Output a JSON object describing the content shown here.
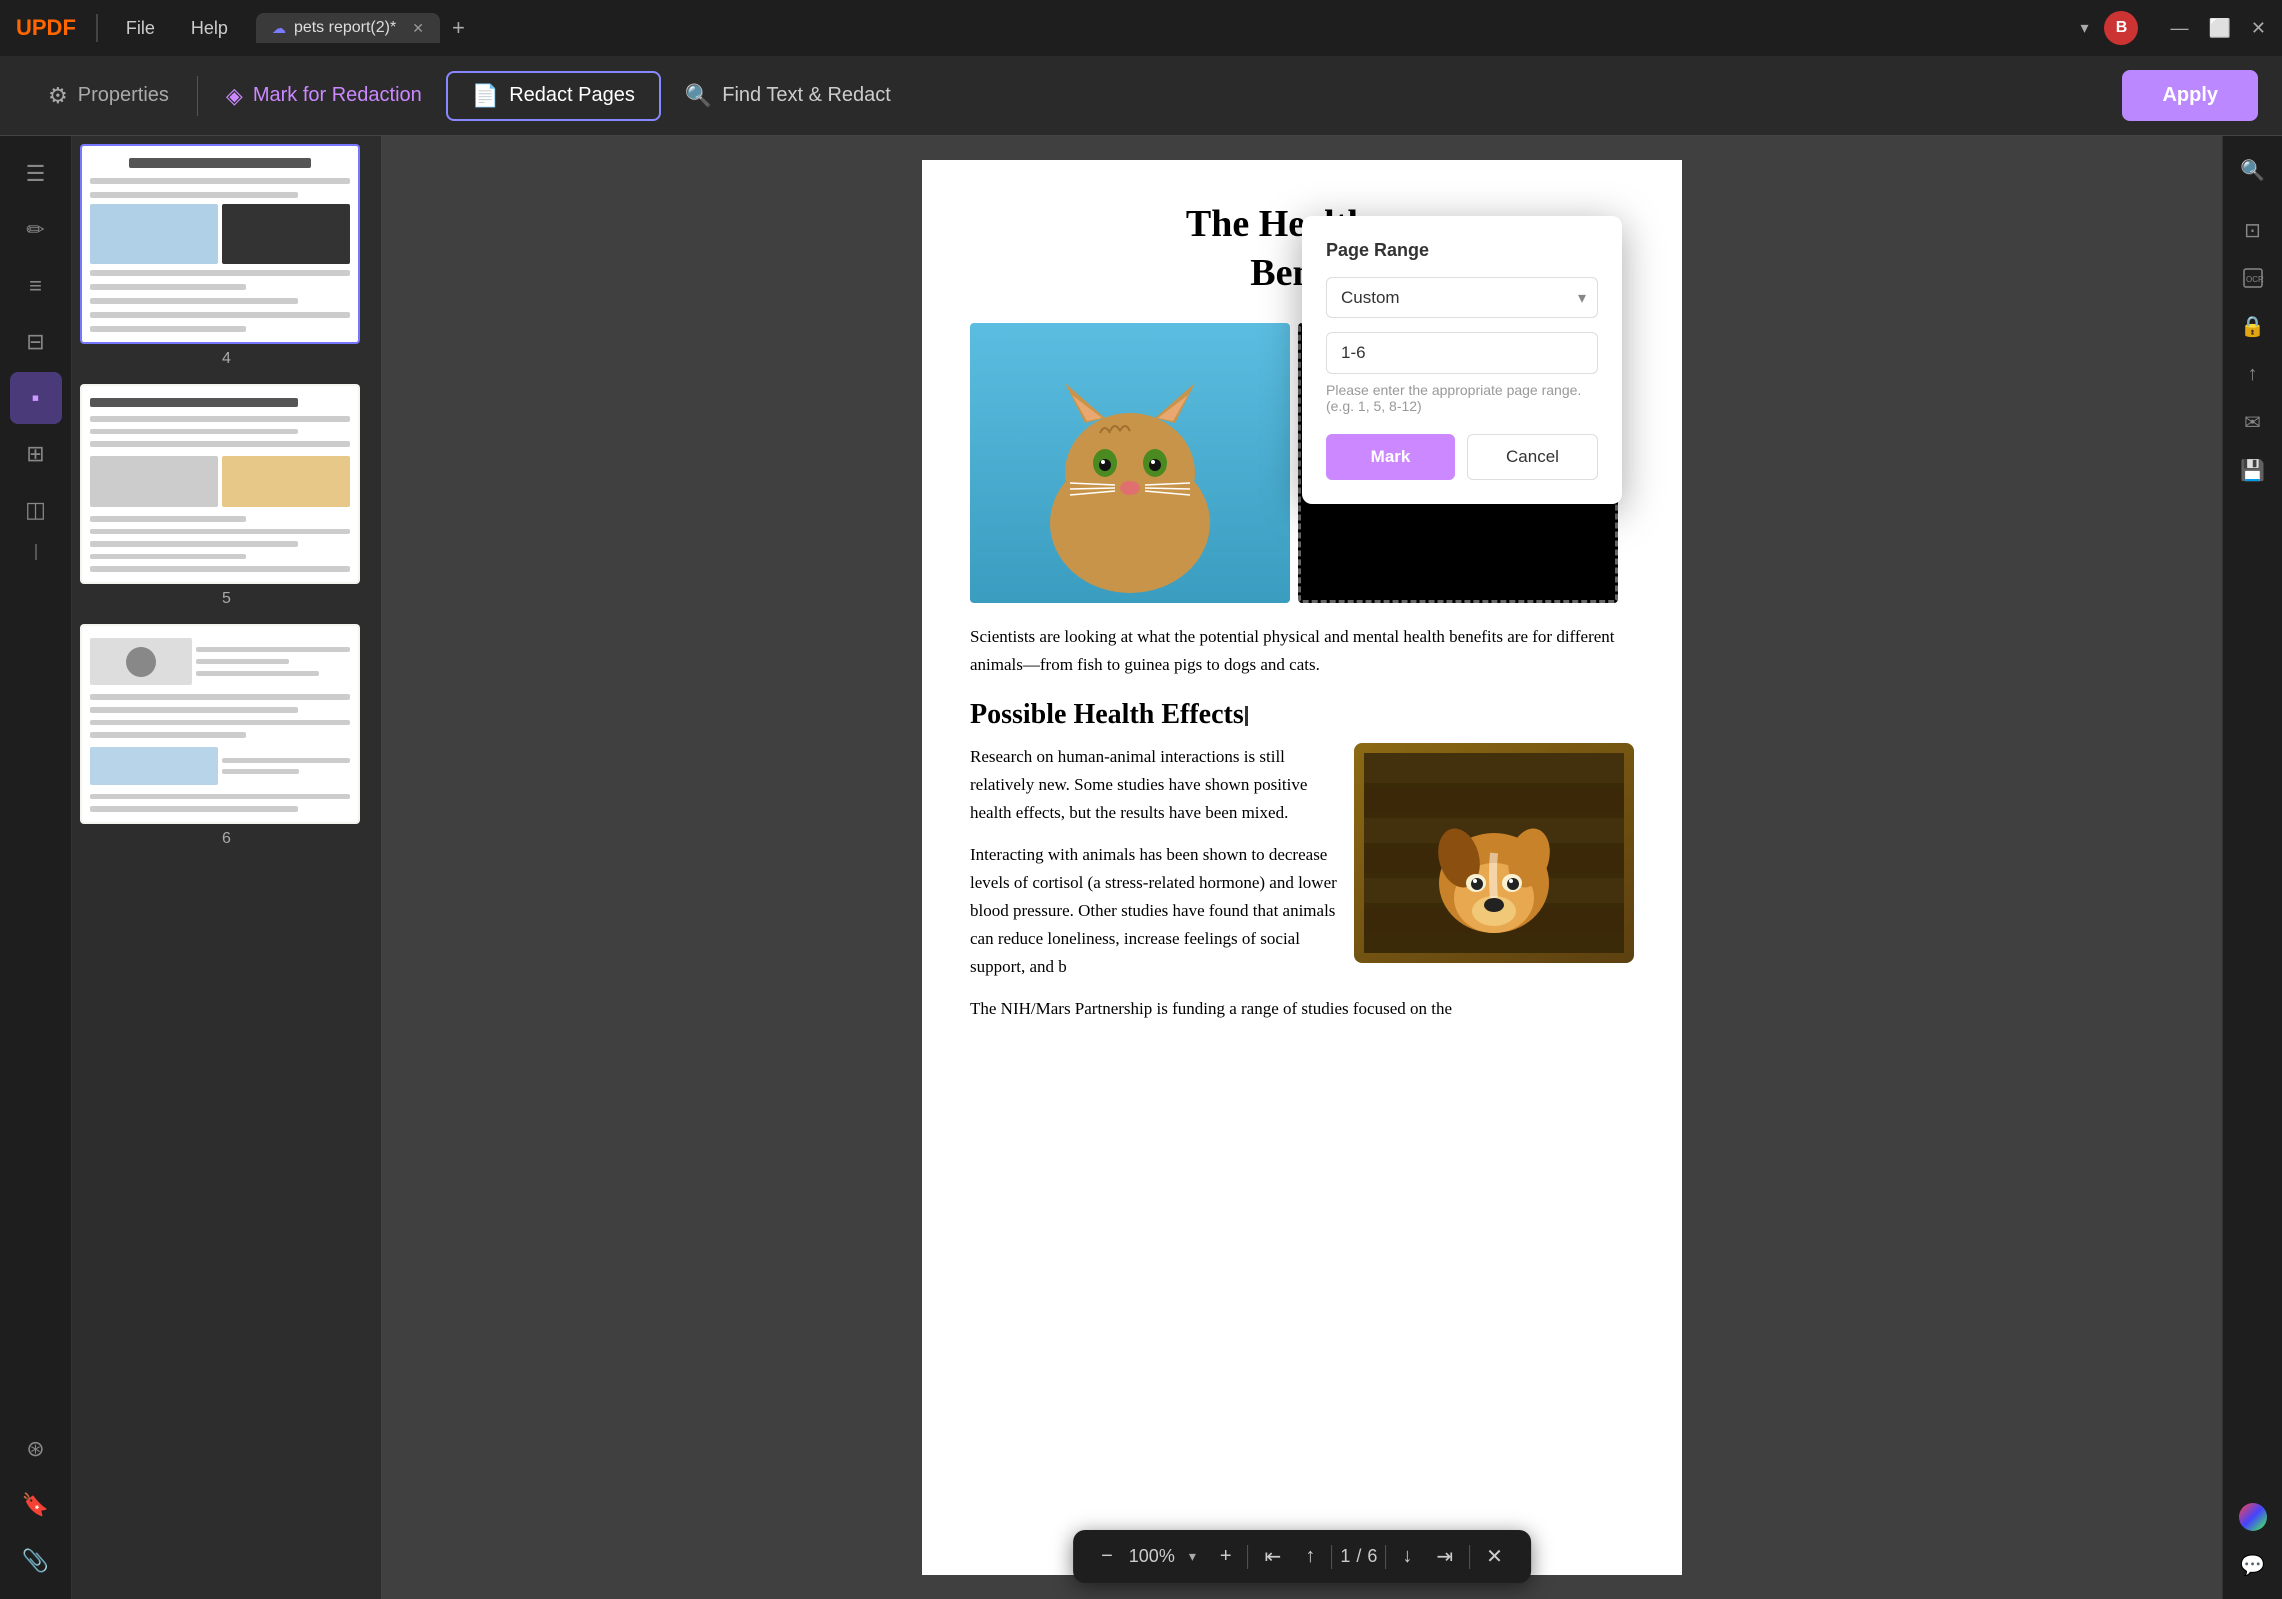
{
  "app": {
    "logo": "UPDF",
    "title_bar": {
      "file_menu": "File",
      "help_menu": "Help",
      "tab_name": "pets report(2)*",
      "tab_icon": "☁",
      "close_tab": "✕",
      "add_tab": "+",
      "dropdown_btn": "▾",
      "avatar_initials": "B",
      "minimize": "—",
      "maximize": "⬜",
      "close_window": "✕"
    }
  },
  "toolbar": {
    "properties_label": "Properties",
    "mark_redaction_label": "Mark for Redaction",
    "redact_pages_label": "Redact Pages",
    "find_redact_label": "Find Text & Redact",
    "apply_label": "Apply"
  },
  "popup": {
    "title": "Page Range",
    "select_option": "Custom",
    "input_value": "1-6",
    "input_placeholder": "Please enter the appropriate page range. (e.g. 1, 5, 8-12)",
    "mark_btn": "Mark",
    "cancel_btn": "Cancel"
  },
  "page": {
    "title_line1": "The Health an",
    "title_line2": "Benefi",
    "section1": "Scientists are looking at what the potential physical and mental health benefits are for different animals—from fish to guinea pigs to dogs and cats.",
    "section_title": "Possible Health Effects",
    "body1": "Research on human-animal interactions is still relatively new. Some studies have shown positive health effects, but the results have been mixed.",
    "body2": "Interacting with animals has been shown to decrease levels of cortisol (a stress-related hormone) and lower blood pressure. Other studies have found that animals can reduce loneliness, increase feelings of social support, and b",
    "body3": "The NIH/Mars Partnership is funding a range of studies focused on the"
  },
  "bottom_bar": {
    "zoom_out": "−",
    "zoom_level": "100%",
    "zoom_in": "+",
    "first_page": "⇤",
    "prev_page": "↑",
    "current_page": "1",
    "separator": "/",
    "total_pages": "6",
    "next_page": "↓",
    "last_page": "⇥",
    "close": "✕"
  },
  "thumbnails": [
    {
      "label": "4"
    },
    {
      "label": "5"
    },
    {
      "label": "6"
    }
  ],
  "sidebar_icons": [
    {
      "name": "reader-icon",
      "glyph": "☰"
    },
    {
      "name": "annotation-icon",
      "glyph": "✏"
    },
    {
      "name": "bookmark-icon",
      "glyph": "🔖"
    },
    {
      "name": "form-icon",
      "glyph": "📋"
    },
    {
      "name": "redact-icon",
      "glyph": "▪"
    },
    {
      "name": "organize-icon",
      "glyph": "⊞"
    },
    {
      "name": "layers-icon",
      "glyph": "◫"
    }
  ],
  "colors": {
    "accent_purple": "#bb88ff",
    "toolbar_active_border": "#8888ff",
    "logo_orange": "#ff6600",
    "avatar_red": "#cc3333"
  }
}
